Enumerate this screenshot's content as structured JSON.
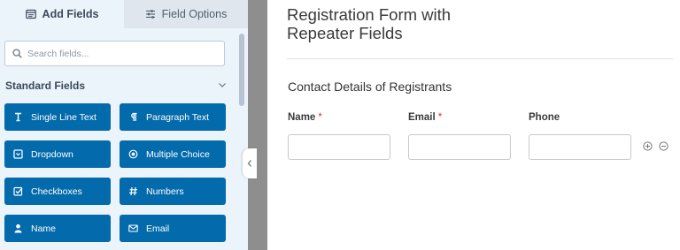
{
  "tabs": [
    {
      "label": "Add Fields",
      "icon": "add-fields-icon",
      "active": true
    },
    {
      "label": "Field Options",
      "icon": "sliders-icon",
      "active": false
    }
  ],
  "search": {
    "placeholder": "Search fields..."
  },
  "section": {
    "title": "Standard Fields",
    "expanded": true
  },
  "fields": [
    {
      "label": "Single Line Text",
      "icon": "text-cursor-icon"
    },
    {
      "label": "Paragraph Text",
      "icon": "pilcrow-icon"
    },
    {
      "label": "Dropdown",
      "icon": "dropdown-icon"
    },
    {
      "label": "Multiple Choice",
      "icon": "radio-icon"
    },
    {
      "label": "Checkboxes",
      "icon": "checkbox-icon"
    },
    {
      "label": "Numbers",
      "icon": "hash-icon"
    },
    {
      "label": "Name",
      "icon": "user-icon"
    },
    {
      "label": "Email",
      "icon": "envelope-icon"
    }
  ],
  "form": {
    "title": "Registration Form with Repeater Fields",
    "section": "Contact Details of Registrants",
    "columns": [
      {
        "label": "Name",
        "required": "*",
        "value": ""
      },
      {
        "label": "Email",
        "required": "*",
        "value": ""
      },
      {
        "label": "Phone",
        "required": "",
        "value": ""
      }
    ]
  },
  "colors": {
    "button": "#036aab",
    "panel": "#ebf3fb",
    "required": "#d63637",
    "divider": "#8e8e8e"
  }
}
